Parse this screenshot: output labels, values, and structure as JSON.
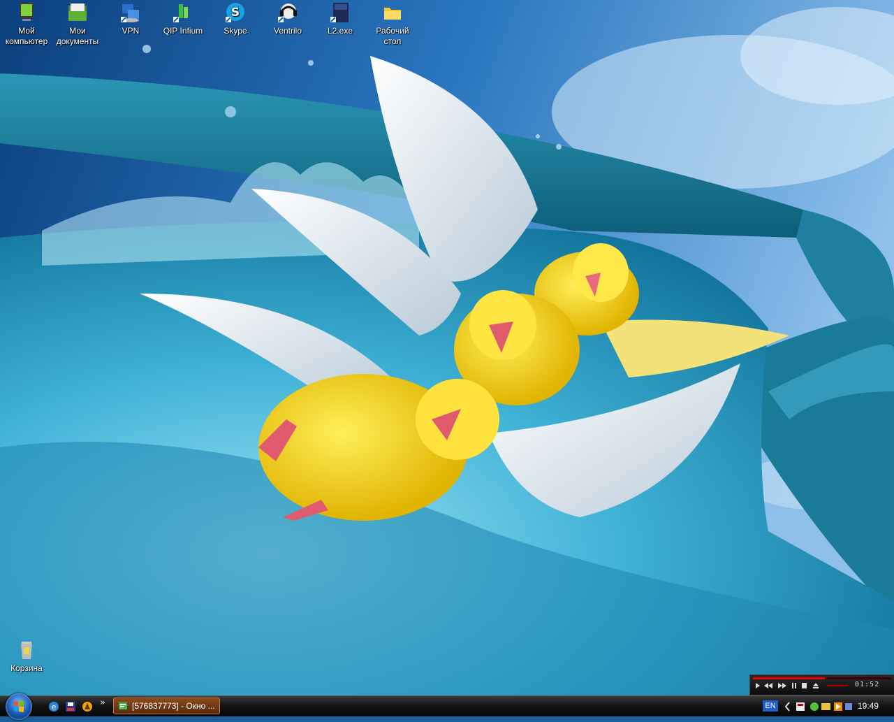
{
  "desktop": {
    "icons": [
      {
        "label": "Мой компьютер",
        "icon": "my-computer-icon"
      },
      {
        "label": "Мои документы",
        "icon": "my-documents-icon"
      },
      {
        "label": "VPN",
        "icon": "vpn-icon"
      },
      {
        "label": "QIP Infium",
        "icon": "qip-infium-icon"
      },
      {
        "label": "Skype",
        "icon": "skype-icon"
      },
      {
        "label": "Ventrilo",
        "icon": "ventrilo-icon"
      },
      {
        "label": "L2.exe",
        "icon": "l2-exe-icon"
      },
      {
        "label": "Рабочий стол",
        "icon": "folder-icon"
      }
    ],
    "recycle_bin": {
      "label": "Корзина",
      "icon": "recycle-bin-icon"
    }
  },
  "taskbar": {
    "task": {
      "label": "[576837773] - Окно ...",
      "icon": "qip-chat-window-icon"
    },
    "quicklaunch_overflow": "»",
    "tray": {
      "language": "EN",
      "time": "19:49"
    }
  },
  "player": {
    "time": "01:52",
    "progress_fraction": 0.52
  },
  "colors": {
    "taskbar": "#141414",
    "task_button": "#7a3d14",
    "sky": "#2f7bc4",
    "water": "#5ec3e0"
  }
}
